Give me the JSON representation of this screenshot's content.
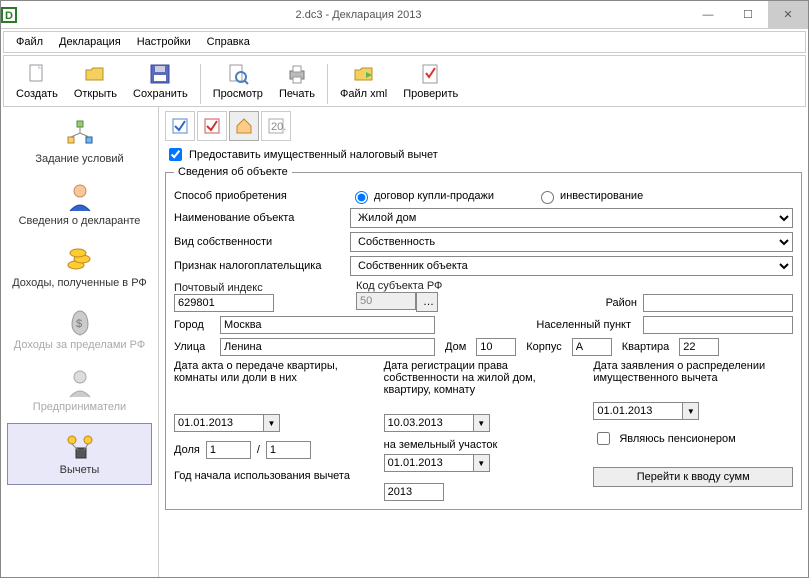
{
  "window": {
    "title": "2.dc3 - Декларация 2013"
  },
  "menu": {
    "file": "Файл",
    "decl": "Декларация",
    "settings": "Настройки",
    "help": "Справка"
  },
  "toolbar": {
    "new": "Создать",
    "open": "Открыть",
    "save": "Сохранить",
    "preview": "Просмотр",
    "print": "Печать",
    "xml": "Файл xml",
    "check": "Проверить"
  },
  "sidebar": {
    "items": [
      {
        "label": "Задание условий"
      },
      {
        "label": "Сведения о декларанте"
      },
      {
        "label": "Доходы, полученные в РФ"
      },
      {
        "label": "Доходы за пределами РФ"
      },
      {
        "label": "Предприниматели"
      },
      {
        "label": "Вычеты"
      }
    ]
  },
  "main": {
    "grant_checkbox": "Предоставить имущественный налоговый вычет",
    "legend": "Сведения об объекте",
    "acq_label": "Способ приобретения",
    "acq_radio1": "договор купли-продажи",
    "acq_radio2": "инвестирование",
    "name_label": "Наименование объекта",
    "name_value": "Жилой дом",
    "own_label": "Вид собственности",
    "own_value": "Собственность",
    "tax_label": "Признак налогоплательщика",
    "tax_value": "Собственник объекта",
    "post_label": "Почтовый индекс",
    "post_value": "629801",
    "region_code_label": "Код субъекта РФ",
    "region_code_value": "50",
    "district_label": "Район",
    "district_value": "",
    "city_label": "Город",
    "city_value": "Москва",
    "settlement_label": "Населенный пункт",
    "settlement_value": "",
    "street_label": "Улица",
    "street_value": "Ленина",
    "house_label": "Дом",
    "house_value": "10",
    "corpus_label": "Корпус",
    "corpus_value": "А",
    "flat_label": "Квартира",
    "flat_value": "22",
    "date_act_label": "Дата акта о передаче квартиры, комнаты или доли в них",
    "date_reg_label": "Дата регистрации права собственности на жилой дом, квартиру, комнату",
    "date_reg_value": "10.03.2013",
    "date_land_label": "на земельный участок",
    "date_land_value": "01.01.2013",
    "date_appl_label": "Дата заявления о распределении имущественного вычета",
    "date_appl_value": "01.01.2013",
    "share_label": "Доля",
    "share_num": "1",
    "share_den": "1",
    "share_sep": "/",
    "year_label": "Год начала использования вычета",
    "year_value": "2013",
    "pens_label": "Являюсь пенсионером",
    "goto_btn": "Перейти к вводу сумм",
    "date_act_value": "01.01.2013"
  }
}
